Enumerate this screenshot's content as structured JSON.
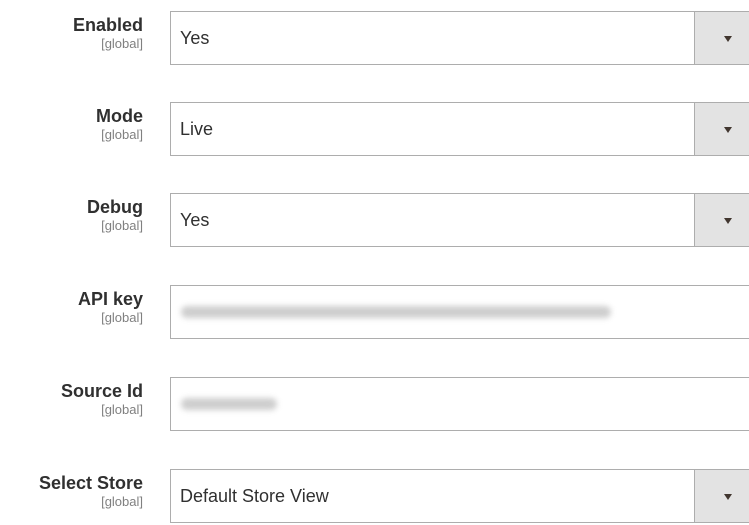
{
  "fields": [
    {
      "label": "Enabled",
      "scope": "[global]",
      "value": "Yes",
      "type": "select"
    },
    {
      "label": "Mode",
      "scope": "[global]",
      "value": "Live",
      "type": "select"
    },
    {
      "label": "Debug",
      "scope": "[global]",
      "value": "Yes",
      "type": "select"
    },
    {
      "label": "API key",
      "scope": "[global]",
      "value": "",
      "type": "text"
    },
    {
      "label": "Source Id",
      "scope": "[global]",
      "value": "",
      "type": "text"
    },
    {
      "label": "Select Store",
      "scope": "[global]",
      "value": "Default Store View",
      "type": "select"
    }
  ],
  "icons": {
    "dropdown": "chevron-down-icon"
  },
  "colors": {
    "border": "#adadad",
    "arrow_bg": "#e3e3e3",
    "text": "#303030",
    "scope": "#808080"
  }
}
